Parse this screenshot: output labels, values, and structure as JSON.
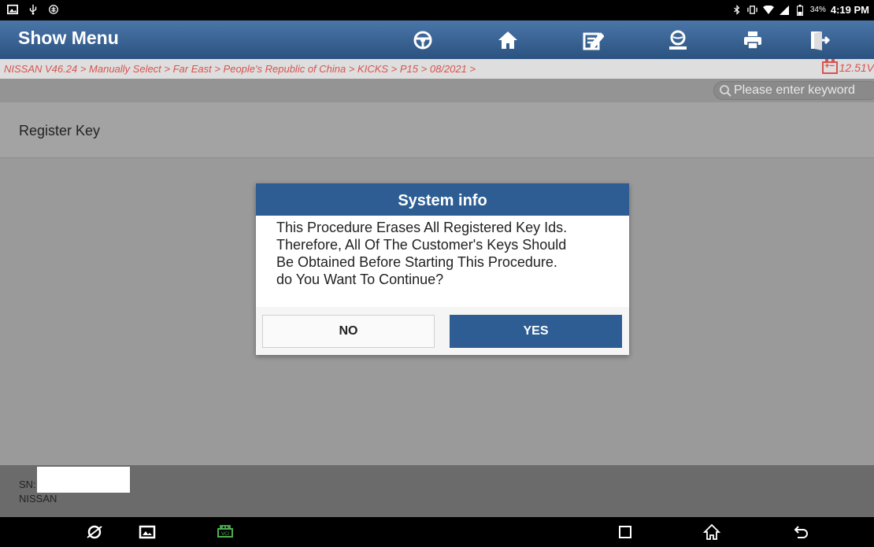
{
  "status_bar": {
    "battery_percent": "34%",
    "time": "4:19 PM"
  },
  "app_bar": {
    "title": "Show Menu",
    "tools": [
      "steering-wheel-icon",
      "home-icon",
      "edit-icon",
      "user-icon",
      "print-icon",
      "exit-icon"
    ]
  },
  "breadcrumb": {
    "text": "NISSAN V46.24 > Manually Select > Far East > People's Republic of China > KICKS > P15 > 08/2021 >"
  },
  "voltage": {
    "value": "12.51V"
  },
  "search": {
    "placeholder": "Please enter keyword"
  },
  "menu": {
    "items": [
      {
        "label": "Register Key"
      }
    ]
  },
  "dialog": {
    "title": "System info",
    "lines": [
      "This Procedure Erases All Registered Key Ids.",
      "Therefore, All Of The Customer's Keys Should",
      "Be Obtained Before Starting This Procedure.",
      "do You Want To Continue?"
    ],
    "no_label": "NO",
    "yes_label": "YES"
  },
  "footer": {
    "sn_label": "SN:",
    "brand": "NISSAN"
  },
  "colors": {
    "header_blue": "#2d5d93",
    "breadcrumb_red": "#d9534f",
    "vci_green": "#4caf50"
  }
}
